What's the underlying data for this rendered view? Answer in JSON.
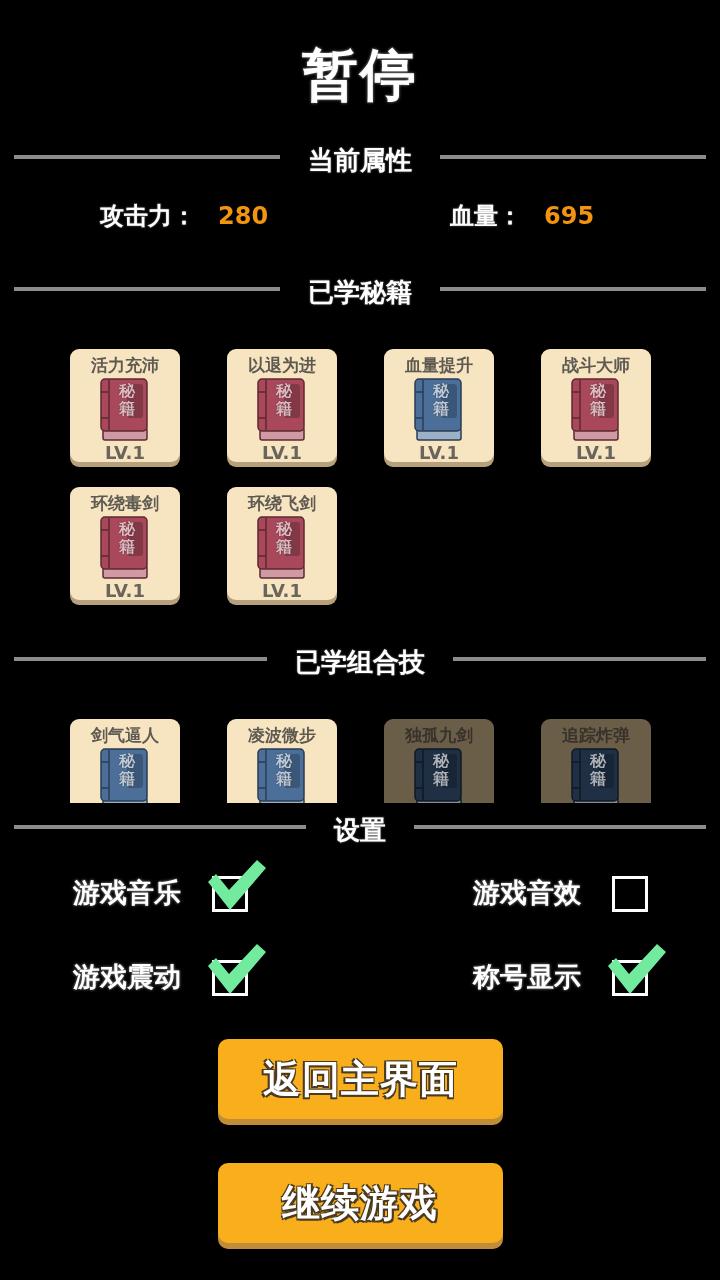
{
  "title": "暂停",
  "attributes": {
    "heading": "当前属性",
    "stats": [
      {
        "label": "攻击力：",
        "value": "280"
      },
      {
        "label": "血量：",
        "value": "695"
      }
    ]
  },
  "learned_books": {
    "heading": "已学秘籍",
    "items": [
      {
        "name": "活力充沛",
        "cover": "秘籍",
        "color": "#a8485a",
        "level_label": "LV.1"
      },
      {
        "name": "以退为进",
        "cover": "秘籍",
        "color": "#a8485a",
        "level_label": "LV.1"
      },
      {
        "name": "血量提升",
        "cover": "秘籍",
        "color": "#4b6f98",
        "level_label": "LV.1"
      },
      {
        "name": "战斗大师",
        "cover": "秘籍",
        "color": "#a8485a",
        "level_label": "LV.1"
      },
      {
        "name": "环绕毒剑",
        "cover": "秘籍",
        "color": "#a8485a",
        "level_label": "LV.1"
      },
      {
        "name": "环绕飞剑",
        "cover": "秘籍",
        "color": "#a8485a",
        "level_label": "LV.1"
      }
    ]
  },
  "combos": {
    "heading": "已学组合技",
    "items": [
      {
        "name": "剑气逼人",
        "cover": "秘籍",
        "color": "#4b6f98",
        "locked": false
      },
      {
        "name": "凌波微步",
        "cover": "秘籍",
        "color": "#4b6f98",
        "locked": false
      },
      {
        "name": "独孤九剑",
        "cover": "秘籍",
        "color": "#1f2f44",
        "locked": true
      },
      {
        "name": "追踪炸弹",
        "cover": "秘籍",
        "color": "#1f2f44",
        "locked": true
      }
    ]
  },
  "settings": {
    "heading": "设置",
    "options": [
      {
        "label": "游戏音乐",
        "checked": true
      },
      {
        "label": "游戏音效",
        "checked": false
      },
      {
        "label": "游戏震动",
        "checked": true
      },
      {
        "label": "称号显示",
        "checked": true
      }
    ]
  },
  "buttons": [
    {
      "label": "返回主界面"
    },
    {
      "label": "继续游戏"
    }
  ]
}
